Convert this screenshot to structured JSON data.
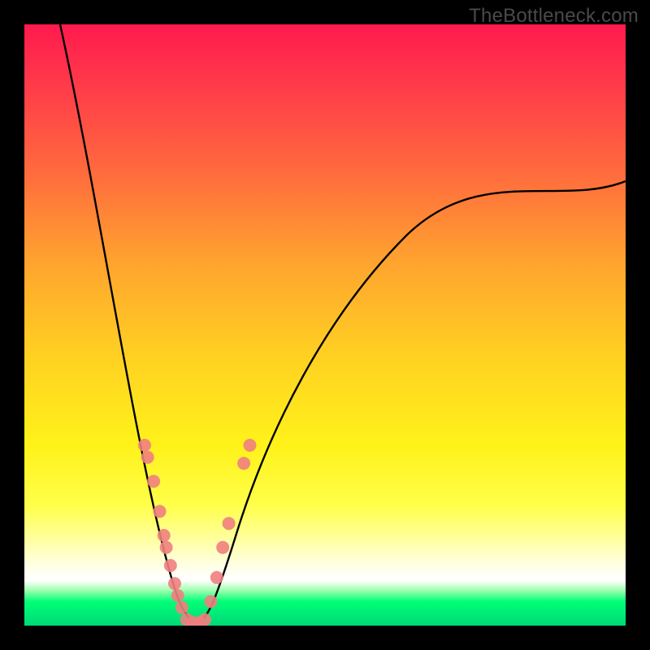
{
  "watermark": "TheBottleneck.com",
  "chart_data": {
    "type": "line",
    "title": "",
    "xlabel": "",
    "ylabel": "",
    "xlim": [
      0,
      100
    ],
    "ylim": [
      0,
      100
    ],
    "background_gradient": {
      "top_color": "#ff1a4d",
      "mid_color": "#fff21a",
      "bottom_color": "#00d877"
    },
    "curve": {
      "description": "V-shaped bottleneck curve; minimum at approximately x=28 where value reaches 0, rising steeply on both sides.",
      "minimum_x": 28,
      "minimum_y": 0,
      "left_endpoint": {
        "x": 6,
        "y": 100
      },
      "right_endpoint": {
        "x": 100,
        "y": 74
      }
    },
    "markers": {
      "color": "#f08080",
      "radius_px": 8,
      "points": [
        {
          "x": 20.0,
          "y": 30
        },
        {
          "x": 20.5,
          "y": 28
        },
        {
          "x": 21.5,
          "y": 24
        },
        {
          "x": 22.5,
          "y": 19
        },
        {
          "x": 23.2,
          "y": 15
        },
        {
          "x": 23.6,
          "y": 13
        },
        {
          "x": 24.3,
          "y": 10
        },
        {
          "x": 25.0,
          "y": 7
        },
        {
          "x": 25.5,
          "y": 5
        },
        {
          "x": 26.2,
          "y": 3
        },
        {
          "x": 27.0,
          "y": 1
        },
        {
          "x": 28.0,
          "y": 0.5
        },
        {
          "x": 29.0,
          "y": 0.5
        },
        {
          "x": 30.0,
          "y": 1
        },
        {
          "x": 31.0,
          "y": 4
        },
        {
          "x": 32.0,
          "y": 8
        },
        {
          "x": 33.0,
          "y": 13
        },
        {
          "x": 34.0,
          "y": 17
        },
        {
          "x": 36.5,
          "y": 27
        },
        {
          "x": 37.5,
          "y": 30
        }
      ]
    }
  }
}
